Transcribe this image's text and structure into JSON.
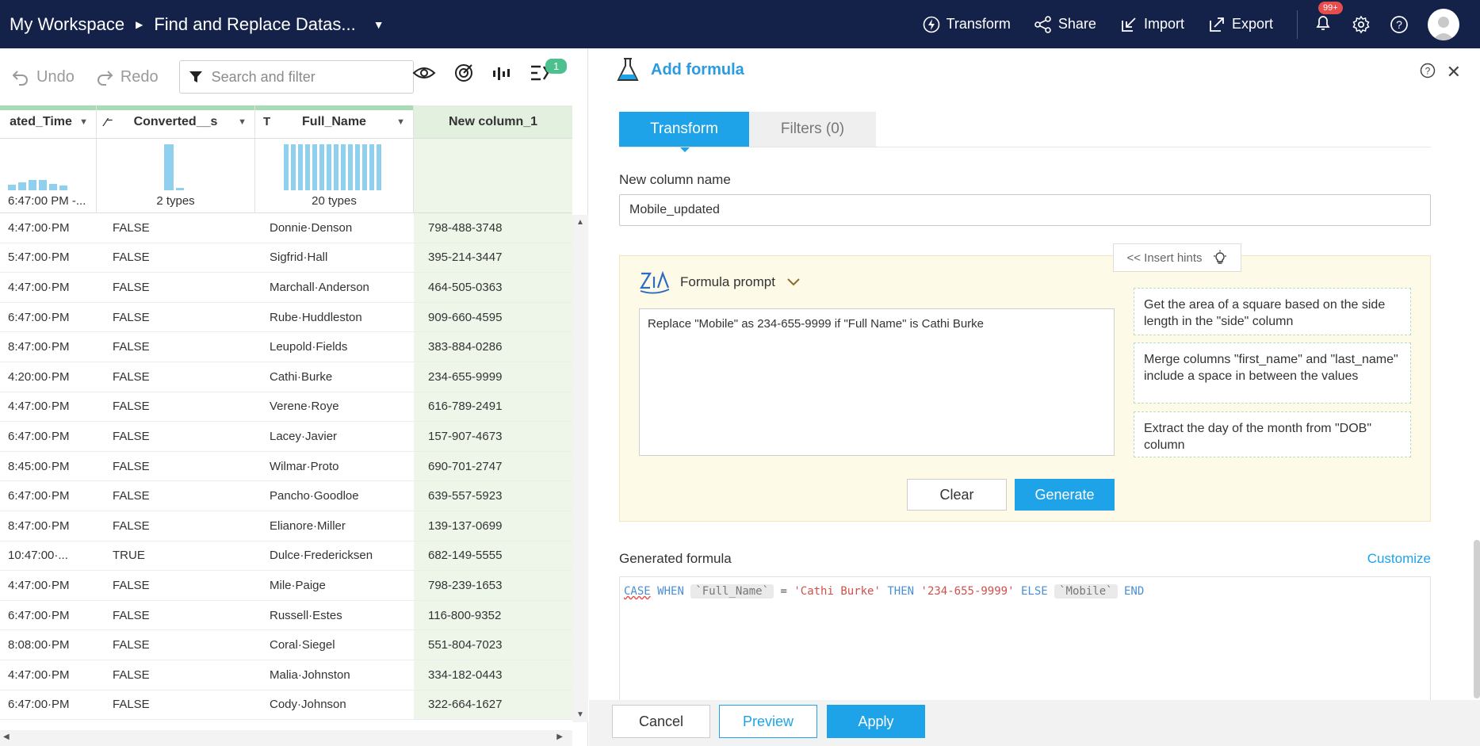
{
  "nav": {
    "workspace": "My Workspace",
    "dataset": "Find and Replace Datas...",
    "actions": [
      {
        "label": "Transform",
        "icon": "lightning-icon"
      },
      {
        "label": "Share",
        "icon": "share-icon"
      },
      {
        "label": "Import",
        "icon": "import-icon"
      },
      {
        "label": "Export",
        "icon": "export-icon"
      }
    ],
    "notification_badge": "99+"
  },
  "toolbar": {
    "undo": "Undo",
    "redo": "Redo",
    "search_placeholder": "Search and filter",
    "badge": "1"
  },
  "grid": {
    "columns": [
      {
        "name": "ated_Time",
        "type_icon": ""
      },
      {
        "name": "Converted__s",
        "type_icon": "⁄"
      },
      {
        "name": "Full_Name",
        "type_icon": "T"
      },
      {
        "name": "New column_1",
        "type_icon": ""
      }
    ],
    "profile": [
      "6:47:00 PM -...",
      "2 types",
      "20 types",
      ""
    ],
    "rows": [
      [
        "4:47:00·PM",
        "FALSE",
        "Donnie·Denson",
        "798-488-3748"
      ],
      [
        "5:47:00·PM",
        "FALSE",
        "Sigfrid·Hall",
        "395-214-3447"
      ],
      [
        "4:47:00·PM",
        "FALSE",
        "Marchall·Anderson",
        "464-505-0363"
      ],
      [
        "6:47:00·PM",
        "FALSE",
        "Rube·Huddleston",
        "909-660-4595"
      ],
      [
        "8:47:00·PM",
        "FALSE",
        "Leupold·Fields",
        "383-884-0286"
      ],
      [
        "4:20:00·PM",
        "FALSE",
        "Cathi·Burke",
        "234-655-9999"
      ],
      [
        "4:47:00·PM",
        "FALSE",
        "Verene·Roye",
        "616-789-2491"
      ],
      [
        "6:47:00·PM",
        "FALSE",
        "Lacey·Javier",
        "157-907-4673"
      ],
      [
        "8:45:00·PM",
        "FALSE",
        "Wilmar·Proto",
        "690-701-2747"
      ],
      [
        "6:47:00·PM",
        "FALSE",
        "Pancho·Goodloe",
        "639-557-5923"
      ],
      [
        "8:47:00·PM",
        "FALSE",
        "Elianore·Miller",
        "139-137-0699"
      ],
      [
        "10:47:00·...",
        "TRUE",
        "Dulce·Fredericksen",
        "682-149-5555"
      ],
      [
        "4:47:00·PM",
        "FALSE",
        "Mile·Paige",
        "798-239-1653"
      ],
      [
        "6:47:00·PM",
        "FALSE",
        "Russell·Estes",
        "116-800-9352"
      ],
      [
        "8:08:00·PM",
        "FALSE",
        "Coral·Siegel",
        "551-804-7023"
      ],
      [
        "4:47:00·PM",
        "FALSE",
        "Malia·Johnston",
        "334-182-0443"
      ],
      [
        "6:47:00·PM",
        "FALSE",
        "Cody·Johnson",
        "322-664-1627"
      ]
    ]
  },
  "formula_panel": {
    "title": "Add formula",
    "tabs": [
      "Transform",
      "Filters (0)"
    ],
    "new_column_label": "New column name",
    "new_column_value": "Mobile_updated",
    "insert_hints": "<< Insert hints",
    "prompt_label": "Formula prompt",
    "prompt_text": "Replace \"Mobile\" as 234-655-9999 if \"Full Name\" is Cathi Burke",
    "clear": "Clear",
    "generate": "Generate",
    "hints": [
      "Get the area of a square based on the side length in the \"side\" column",
      "Merge columns \"first_name\" and \"last_name\" include a space in between the values",
      "Extract the day of the month from \"DOB\" column"
    ],
    "generated_label": "Generated formula",
    "customize": "Customize",
    "formula": {
      "case": "CASE",
      "when": "WHEN",
      "col1": "`Full_Name`",
      "eq": "=",
      "val1": "'Cathi Burke'",
      "then": "THEN",
      "val2": "'234-655-9999'",
      "else": "ELSE",
      "col2": "`Mobile`",
      "end": "END"
    },
    "footer": {
      "cancel": "Cancel",
      "preview": "Preview",
      "apply": "Apply"
    }
  },
  "colors": {
    "navbar": "#14224a",
    "accent": "#1ea3e8",
    "new_column_bg": "#eef6ea",
    "prompt_bg": "#fefae8"
  }
}
